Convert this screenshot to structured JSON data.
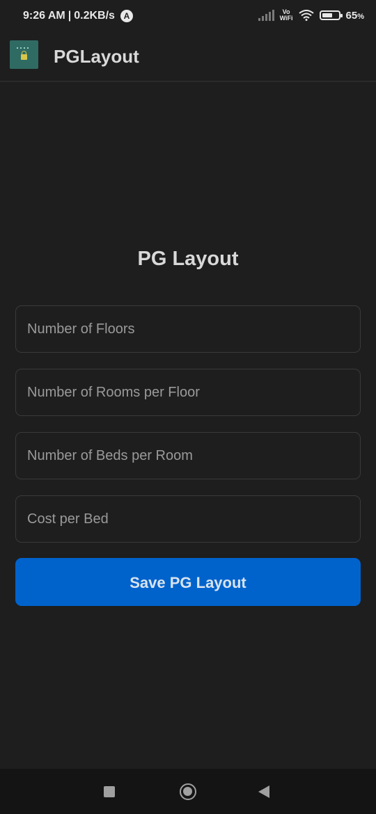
{
  "status_bar": {
    "time": "9:26 AM",
    "separator": "|",
    "speed": "0.2KB/s",
    "nav_badge": "A",
    "vo": "Vo",
    "wifi_label": "WiFi",
    "battery_level": 65,
    "battery": "65",
    "battery_unit": "%"
  },
  "app_bar": {
    "title": "PGLayout"
  },
  "main": {
    "title": "PG Layout",
    "fields": {
      "floors_placeholder": "Number of Floors",
      "rooms_placeholder": "Number of Rooms per Floor",
      "beds_placeholder": "Number of Beds per Room",
      "cost_placeholder": "Cost per Bed"
    },
    "save_label": "Save PG Layout"
  },
  "colors": {
    "background": "#1e1e1e",
    "accent": "#0063cc"
  }
}
